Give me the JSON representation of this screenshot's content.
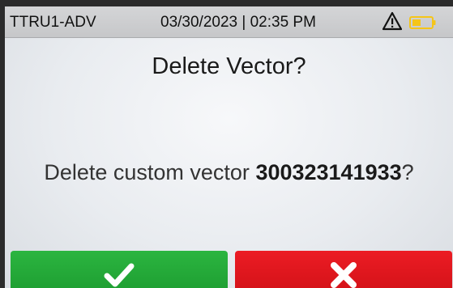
{
  "status_bar": {
    "device_id": "TTRU1-ADV",
    "datetime": "03/30/2023 | 02:35 PM",
    "warning_icon": "warning-triangle-icon",
    "battery_icon": "battery-icon",
    "battery_color": "#f5c518"
  },
  "dialog": {
    "title": "Delete Vector?",
    "message_prefix": "Delete custom vector ",
    "vector_id": "300323141933",
    "message_suffix": "?"
  },
  "buttons": {
    "confirm_icon": "checkmark-icon",
    "confirm_color": "#22a836",
    "cancel_icon": "close-x-icon",
    "cancel_color": "#e0161d"
  }
}
